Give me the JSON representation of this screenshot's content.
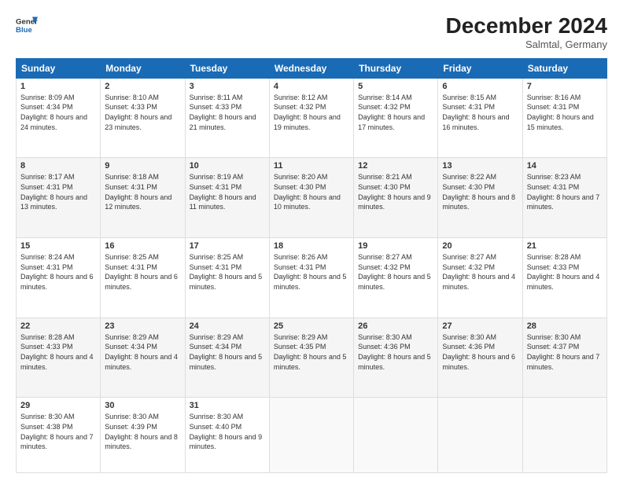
{
  "header": {
    "logo_line1": "General",
    "logo_line2": "Blue",
    "month": "December 2024",
    "location": "Salmtal, Germany"
  },
  "days_of_week": [
    "Sunday",
    "Monday",
    "Tuesday",
    "Wednesday",
    "Thursday",
    "Friday",
    "Saturday"
  ],
  "weeks": [
    [
      {
        "day": "1",
        "sunrise": "Sunrise: 8:09 AM",
        "sunset": "Sunset: 4:34 PM",
        "daylight": "Daylight: 8 hours and 24 minutes."
      },
      {
        "day": "2",
        "sunrise": "Sunrise: 8:10 AM",
        "sunset": "Sunset: 4:33 PM",
        "daylight": "Daylight: 8 hours and 23 minutes."
      },
      {
        "day": "3",
        "sunrise": "Sunrise: 8:11 AM",
        "sunset": "Sunset: 4:33 PM",
        "daylight": "Daylight: 8 hours and 21 minutes."
      },
      {
        "day": "4",
        "sunrise": "Sunrise: 8:12 AM",
        "sunset": "Sunset: 4:32 PM",
        "daylight": "Daylight: 8 hours and 19 minutes."
      },
      {
        "day": "5",
        "sunrise": "Sunrise: 8:14 AM",
        "sunset": "Sunset: 4:32 PM",
        "daylight": "Daylight: 8 hours and 17 minutes."
      },
      {
        "day": "6",
        "sunrise": "Sunrise: 8:15 AM",
        "sunset": "Sunset: 4:31 PM",
        "daylight": "Daylight: 8 hours and 16 minutes."
      },
      {
        "day": "7",
        "sunrise": "Sunrise: 8:16 AM",
        "sunset": "Sunset: 4:31 PM",
        "daylight": "Daylight: 8 hours and 15 minutes."
      }
    ],
    [
      {
        "day": "8",
        "sunrise": "Sunrise: 8:17 AM",
        "sunset": "Sunset: 4:31 PM",
        "daylight": "Daylight: 8 hours and 13 minutes."
      },
      {
        "day": "9",
        "sunrise": "Sunrise: 8:18 AM",
        "sunset": "Sunset: 4:31 PM",
        "daylight": "Daylight: 8 hours and 12 minutes."
      },
      {
        "day": "10",
        "sunrise": "Sunrise: 8:19 AM",
        "sunset": "Sunset: 4:31 PM",
        "daylight": "Daylight: 8 hours and 11 minutes."
      },
      {
        "day": "11",
        "sunrise": "Sunrise: 8:20 AM",
        "sunset": "Sunset: 4:30 PM",
        "daylight": "Daylight: 8 hours and 10 minutes."
      },
      {
        "day": "12",
        "sunrise": "Sunrise: 8:21 AM",
        "sunset": "Sunset: 4:30 PM",
        "daylight": "Daylight: 8 hours and 9 minutes."
      },
      {
        "day": "13",
        "sunrise": "Sunrise: 8:22 AM",
        "sunset": "Sunset: 4:30 PM",
        "daylight": "Daylight: 8 hours and 8 minutes."
      },
      {
        "day": "14",
        "sunrise": "Sunrise: 8:23 AM",
        "sunset": "Sunset: 4:31 PM",
        "daylight": "Daylight: 8 hours and 7 minutes."
      }
    ],
    [
      {
        "day": "15",
        "sunrise": "Sunrise: 8:24 AM",
        "sunset": "Sunset: 4:31 PM",
        "daylight": "Daylight: 8 hours and 6 minutes."
      },
      {
        "day": "16",
        "sunrise": "Sunrise: 8:25 AM",
        "sunset": "Sunset: 4:31 PM",
        "daylight": "Daylight: 8 hours and 6 minutes."
      },
      {
        "day": "17",
        "sunrise": "Sunrise: 8:25 AM",
        "sunset": "Sunset: 4:31 PM",
        "daylight": "Daylight: 8 hours and 5 minutes."
      },
      {
        "day": "18",
        "sunrise": "Sunrise: 8:26 AM",
        "sunset": "Sunset: 4:31 PM",
        "daylight": "Daylight: 8 hours and 5 minutes."
      },
      {
        "day": "19",
        "sunrise": "Sunrise: 8:27 AM",
        "sunset": "Sunset: 4:32 PM",
        "daylight": "Daylight: 8 hours and 5 minutes."
      },
      {
        "day": "20",
        "sunrise": "Sunrise: 8:27 AM",
        "sunset": "Sunset: 4:32 PM",
        "daylight": "Daylight: 8 hours and 4 minutes."
      },
      {
        "day": "21",
        "sunrise": "Sunrise: 8:28 AM",
        "sunset": "Sunset: 4:33 PM",
        "daylight": "Daylight: 8 hours and 4 minutes."
      }
    ],
    [
      {
        "day": "22",
        "sunrise": "Sunrise: 8:28 AM",
        "sunset": "Sunset: 4:33 PM",
        "daylight": "Daylight: 8 hours and 4 minutes."
      },
      {
        "day": "23",
        "sunrise": "Sunrise: 8:29 AM",
        "sunset": "Sunset: 4:34 PM",
        "daylight": "Daylight: 8 hours and 4 minutes."
      },
      {
        "day": "24",
        "sunrise": "Sunrise: 8:29 AM",
        "sunset": "Sunset: 4:34 PM",
        "daylight": "Daylight: 8 hours and 5 minutes."
      },
      {
        "day": "25",
        "sunrise": "Sunrise: 8:29 AM",
        "sunset": "Sunset: 4:35 PM",
        "daylight": "Daylight: 8 hours and 5 minutes."
      },
      {
        "day": "26",
        "sunrise": "Sunrise: 8:30 AM",
        "sunset": "Sunset: 4:36 PM",
        "daylight": "Daylight: 8 hours and 5 minutes."
      },
      {
        "day": "27",
        "sunrise": "Sunrise: 8:30 AM",
        "sunset": "Sunset: 4:36 PM",
        "daylight": "Daylight: 8 hours and 6 minutes."
      },
      {
        "day": "28",
        "sunrise": "Sunrise: 8:30 AM",
        "sunset": "Sunset: 4:37 PM",
        "daylight": "Daylight: 8 hours and 7 minutes."
      }
    ],
    [
      {
        "day": "29",
        "sunrise": "Sunrise: 8:30 AM",
        "sunset": "Sunset: 4:38 PM",
        "daylight": "Daylight: 8 hours and 7 minutes."
      },
      {
        "day": "30",
        "sunrise": "Sunrise: 8:30 AM",
        "sunset": "Sunset: 4:39 PM",
        "daylight": "Daylight: 8 hours and 8 minutes."
      },
      {
        "day": "31",
        "sunrise": "Sunrise: 8:30 AM",
        "sunset": "Sunset: 4:40 PM",
        "daylight": "Daylight: 8 hours and 9 minutes."
      },
      null,
      null,
      null,
      null
    ]
  ]
}
